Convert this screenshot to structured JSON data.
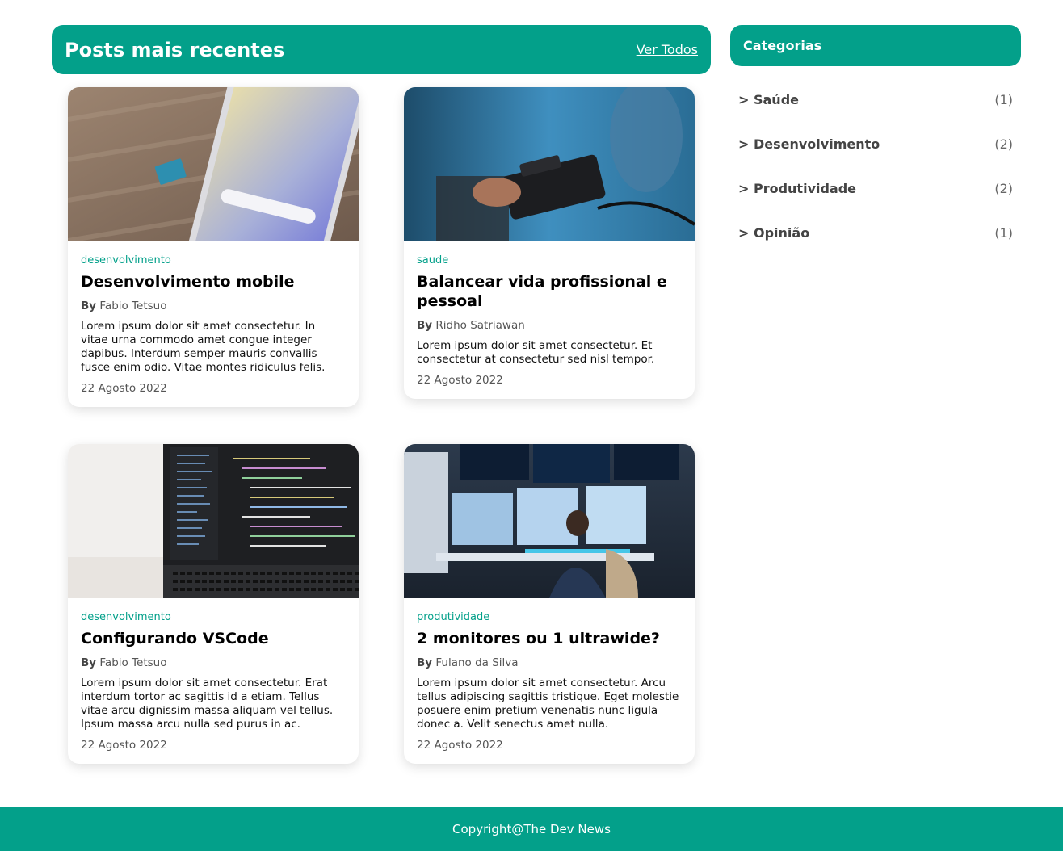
{
  "posts_header": {
    "title": "Posts mais recentes",
    "view_all": "Ver Todos"
  },
  "posts": [
    {
      "category": "desenvolvimento",
      "title": "Desenvolvimento mobile",
      "by": "By",
      "author": "Fabio Tetsuo",
      "excerpt": "Lorem ipsum dolor sit amet consectetur. In vitae urna commodo amet congue integer dapibus. Interdum semper mauris convallis fusce enim odio. Vitae montes ridiculus felis.",
      "date": "22 Agosto 2022"
    },
    {
      "category": "saude",
      "title": "Balancear vida profissional e pessoal",
      "by": "By",
      "author": "Ridho Satriawan",
      "excerpt": "Lorem ipsum dolor sit amet consectetur. Et consectetur at consectetur sed nisl tempor.",
      "date": "22 Agosto 2022"
    },
    {
      "category": "desenvolvimento",
      "title": "Configurando VSCode",
      "by": "By",
      "author": "Fabio Tetsuo",
      "excerpt": "Lorem ipsum dolor sit amet consectetur. Erat interdum tortor ac sagittis id a etiam. Tellus vitae arcu dignissim massa aliquam vel tellus. Ipsum massa arcu nulla sed purus in ac.",
      "date": "22 Agosto 2022"
    },
    {
      "category": "produtividade",
      "title": "2 monitores ou 1 ultrawide?",
      "by": "By",
      "author": "Fulano da Silva",
      "excerpt": "Lorem ipsum dolor sit amet consectetur. Arcu tellus adipiscing sagittis tristique. Eget molestie posuere enim pretium venenatis nunc ligula donec a. Velit senectus amet nulla.",
      "date": "22 Agosto 2022"
    }
  ],
  "categories": {
    "title": "Categorias",
    "items": [
      {
        "label": "> Saúde",
        "count": "(1)"
      },
      {
        "label": "> Desenvolvimento",
        "count": "(2)"
      },
      {
        "label": "> Produtividade",
        "count": "(2)"
      },
      {
        "label": "> Opinião",
        "count": "(1)"
      }
    ]
  },
  "footer": {
    "text": "Copyright@The Dev News"
  },
  "colors": {
    "accent": "#03a08a"
  }
}
